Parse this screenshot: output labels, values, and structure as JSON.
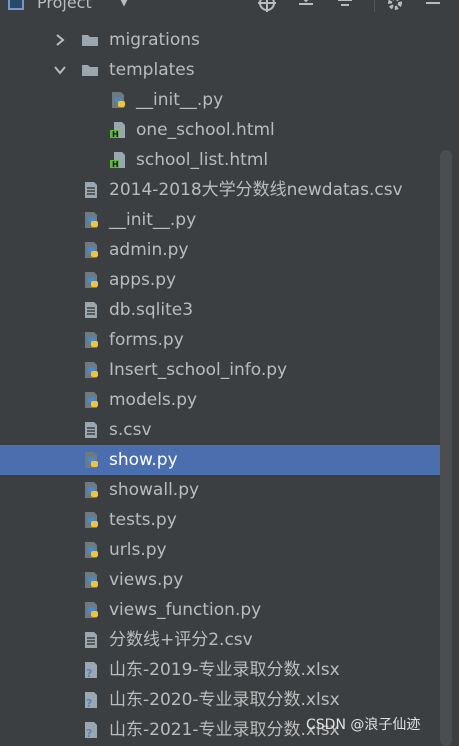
{
  "toolbar": {
    "title": "Project",
    "icons": [
      "project-icon",
      "dropdown-caret-icon",
      "locate-icon",
      "expand-all-icon",
      "collapse-all-icon",
      "gear-icon",
      "minimize-icon"
    ]
  },
  "tree": [
    {
      "label": "migrations",
      "type": "folder",
      "expanded": false
    },
    {
      "label": "templates",
      "type": "folder",
      "expanded": true
    },
    {
      "label": "__init__.py",
      "type": "python"
    },
    {
      "label": "one_school.html",
      "type": "html"
    },
    {
      "label": "school_list.html",
      "type": "html"
    },
    {
      "label": "2014-2018大学分数线newdatas.csv",
      "type": "text"
    },
    {
      "label": "__init__.py",
      "type": "python"
    },
    {
      "label": "admin.py",
      "type": "python"
    },
    {
      "label": "apps.py",
      "type": "python"
    },
    {
      "label": "db.sqlite3",
      "type": "text"
    },
    {
      "label": "forms.py",
      "type": "python"
    },
    {
      "label": "Insert_school_info.py",
      "type": "python"
    },
    {
      "label": "models.py",
      "type": "python"
    },
    {
      "label": "s.csv",
      "type": "text"
    },
    {
      "label": "show.py",
      "type": "python",
      "selected": true
    },
    {
      "label": "showall.py",
      "type": "python"
    },
    {
      "label": "tests.py",
      "type": "python"
    },
    {
      "label": "urls.py",
      "type": "python"
    },
    {
      "label": "views.py",
      "type": "python"
    },
    {
      "label": "views_function.py",
      "type": "python"
    },
    {
      "label": "分数线+评分2.csv",
      "type": "text"
    },
    {
      "label": "山东-2019-专业录取分数.xlsx",
      "type": "unknown"
    },
    {
      "label": "山东-2020-专业录取分数.xlsx",
      "type": "unknown"
    },
    {
      "label": "山东-2021-专业录取分数.xlsx",
      "type": "unknown"
    }
  ],
  "colors": {
    "background": "#3c3f41",
    "selection": "#4b6eaf",
    "text": "#bbbbbb",
    "python_blue": "#4a88c7",
    "python_yellow": "#f0c53b",
    "html_green": "#62b543"
  },
  "watermark": "CSDN @浪子仙迹"
}
